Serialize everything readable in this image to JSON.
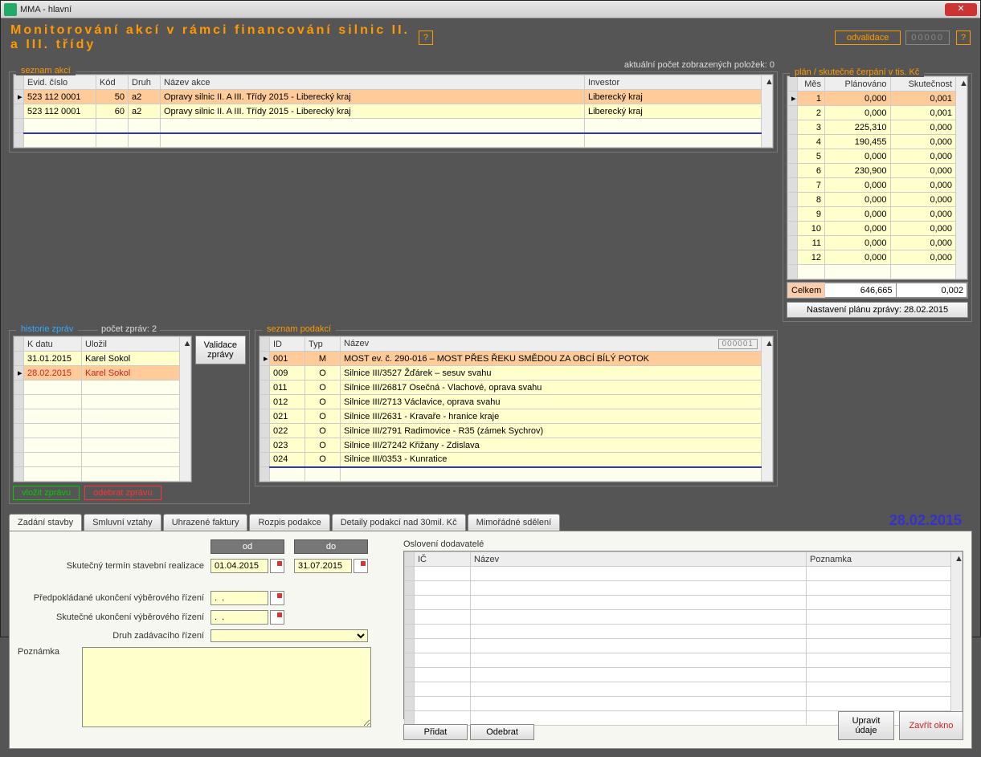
{
  "window": {
    "title": "MMA - hlavní"
  },
  "header": {
    "title": "Monitorování akcí v rámci financování silnic II. a III. třídy",
    "odvalidace": "odvalidace",
    "counter": "00000"
  },
  "seznam_akci": {
    "title": "seznam akcí",
    "status": "aktuální počet zobrazených položek: 0",
    "cols": {
      "evid": "Evid. číslo",
      "kod": "Kód",
      "druh": "Druh",
      "nazev": "Název akce",
      "investor": "Investor"
    },
    "rows": [
      {
        "evid": "523 112 0001",
        "kod": "50",
        "druh": "a2",
        "nazev": "Opravy silnic II. A III. Třídy 2015 - Liberecký kraj",
        "investor": "Liberecký kraj",
        "sel": true
      },
      {
        "evid": "523 112 0001",
        "kod": "60",
        "druh": "a2",
        "nazev": "Opravy silnic II. A III. Třídy 2015 - Liberecký kraj",
        "investor": "Liberecký kraj",
        "sel": false
      }
    ]
  },
  "plan": {
    "title": "plán / skutečné čerpání v tis. Kč",
    "cols": {
      "mes": "Měs",
      "plan": "Plánováno",
      "skut": "Skutečnost"
    },
    "rows": [
      {
        "m": "1",
        "p": "0,000",
        "s": "0,001"
      },
      {
        "m": "2",
        "p": "0,000",
        "s": "0,001"
      },
      {
        "m": "3",
        "p": "225,310",
        "s": "0,000"
      },
      {
        "m": "4",
        "p": "190,455",
        "s": "0,000"
      },
      {
        "m": "5",
        "p": "0,000",
        "s": "0,000"
      },
      {
        "m": "6",
        "p": "230,900",
        "s": "0,000"
      },
      {
        "m": "7",
        "p": "0,000",
        "s": "0,000"
      },
      {
        "m": "8",
        "p": "0,000",
        "s": "0,000"
      },
      {
        "m": "9",
        "p": "0,000",
        "s": "0,000"
      },
      {
        "m": "10",
        "p": "0,000",
        "s": "0,000"
      },
      {
        "m": "11",
        "p": "0,000",
        "s": "0,000"
      },
      {
        "m": "12",
        "p": "0,000",
        "s": "0,000"
      }
    ],
    "total_label": "Celkem",
    "total_p": "646,665",
    "total_s": "0,002",
    "settings_btn": "Nastavení plánu zprávy: 28.02.2015"
  },
  "historie": {
    "title": "historie zpráv",
    "count_label": "počet zpráv: 2",
    "cols": {
      "kdatu": "K datu",
      "ulozil": "Uložil"
    },
    "rows": [
      {
        "d": "31.01.2015",
        "u": "Karel Sokol",
        "sel": false
      },
      {
        "d": "28.02.2015",
        "u": "Karel Sokol",
        "sel": true
      }
    ],
    "validate_btn": "Validace\nzprávy",
    "insert_btn": "vložit zprávu",
    "remove_btn": "odebrat zprávu"
  },
  "podakce": {
    "title": "seznam podakcí",
    "subid": "000001",
    "cols": {
      "id": "ID",
      "typ": "Typ",
      "nazev": "Název"
    },
    "rows": [
      {
        "id": "001",
        "typ": "M",
        "nazev": "MOST ev. č. 290-016 – MOST PŘES ŘEKU SMĚDOU ZA OBCÍ BÍLÝ POTOK",
        "sel": true
      },
      {
        "id": "009",
        "typ": "O",
        "nazev": "Silnice III/3527 Žďárek – sesuv svahu"
      },
      {
        "id": "011",
        "typ": "O",
        "nazev": "Silnice III/26817 Osečná - Vlachové, oprava svahu"
      },
      {
        "id": "012",
        "typ": "O",
        "nazev": "Silnice III/2713 Václavice, oprava svahu"
      },
      {
        "id": "021",
        "typ": "O",
        "nazev": "Silnice III/2631 - Kravaře - hranice kraje"
      },
      {
        "id": "022",
        "typ": "O",
        "nazev": "Silnice III/2791 Radimovice - R35 (zámek Sychrov)"
      },
      {
        "id": "023",
        "typ": "O",
        "nazev": "Silnice III/27242 Křižany - Zdislava"
      },
      {
        "id": "024",
        "typ": "O",
        "nazev": "Silnice III/0353 - Kunratice"
      }
    ]
  },
  "tabs": {
    "items": [
      "Zadání stavby",
      "Smluvní vztahy",
      "Uhrazené faktury",
      "Rozpis podakce",
      "Detaily podakcí nad 30mil. Kč",
      "Mimořádné sdělení"
    ],
    "date": "28.02.2015"
  },
  "form": {
    "od_label": "od",
    "do_label": "do",
    "realizace_label": "Skutečný termín stavební realizace",
    "realizace_od": "01.04.2015",
    "realizace_do": "31.07.2015",
    "predukonc_label": "Předpokládané ukončení výběrového řízení",
    "predukonc": ".  .",
    "skutukonc_label": "Skutečné ukončení výběrového řízení",
    "skutukonc": ".  .",
    "druh_label": "Druh zadávacího řízení",
    "poznamka_label": "Poznámka",
    "dodav_title": "Oslovení dodavatelé",
    "dodav_cols": {
      "ic": "IČ",
      "nazev": "Název",
      "pozn": "Poznamka"
    },
    "pridat": "Přidat",
    "odebrat": "Odebrat",
    "upravit": "Upravit\núdaje",
    "zavrit": "Zavřít okno"
  }
}
